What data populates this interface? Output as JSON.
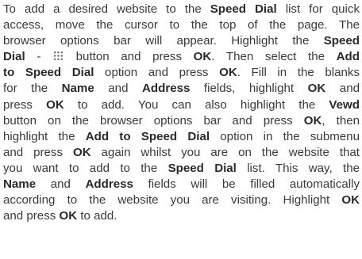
{
  "paragraph": {
    "line1": {
      "a": "To add a desired website to the ",
      "b1": "Speed Dial",
      "c": " list for quick"
    },
    "line2": {
      "a": "access, move the cursor to the top of the page. The"
    },
    "line3": {
      "a": "browser options bar will appear. Highlight the ",
      "b1": "Speed"
    },
    "line4": {
      "b1": "Dial",
      "a": " - ",
      "icon": "grid-icon",
      "c": " button and press ",
      "b2": "OK",
      "d": ". Then select the ",
      "b3": "Add"
    },
    "line5": {
      "b1": "to Speed Dial",
      "a": " option and press ",
      "b2": "OK",
      "c": ". Fill in the blanks"
    },
    "line6": {
      "a": "for the ",
      "b1": "Name",
      "c": " and ",
      "b2": "Address",
      "d": " fields, highlight ",
      "b3": "OK",
      "e": " and"
    },
    "line7": {
      "a": "press ",
      "b1": "OK",
      "c": " to add. You can also highlight the ",
      "b2": "Vewd"
    },
    "line8": {
      "a": "button on the browser options bar and press ",
      "b1": "OK",
      "c": ", then"
    },
    "line9": {
      "a": "highlight the ",
      "b1": "Add to Speed Dial",
      "c": " option in the submenu"
    },
    "line10": {
      "a": "and press ",
      "b1": "OK",
      "c": " again whilst you are on the website that"
    },
    "line11": {
      "a": "you want to add to the ",
      "b1": "Speed Dial",
      "c": " list. This way, the"
    },
    "line12": {
      "b1": "Name",
      "a": " and ",
      "b2": "Address",
      "c": " fields will be filled automatically"
    },
    "line13": {
      "a": "according to the website you are visiting. Highlight ",
      "b1": "OK"
    },
    "line14": {
      "a": "and press ",
      "b1": "OK",
      "c": " to add."
    }
  }
}
